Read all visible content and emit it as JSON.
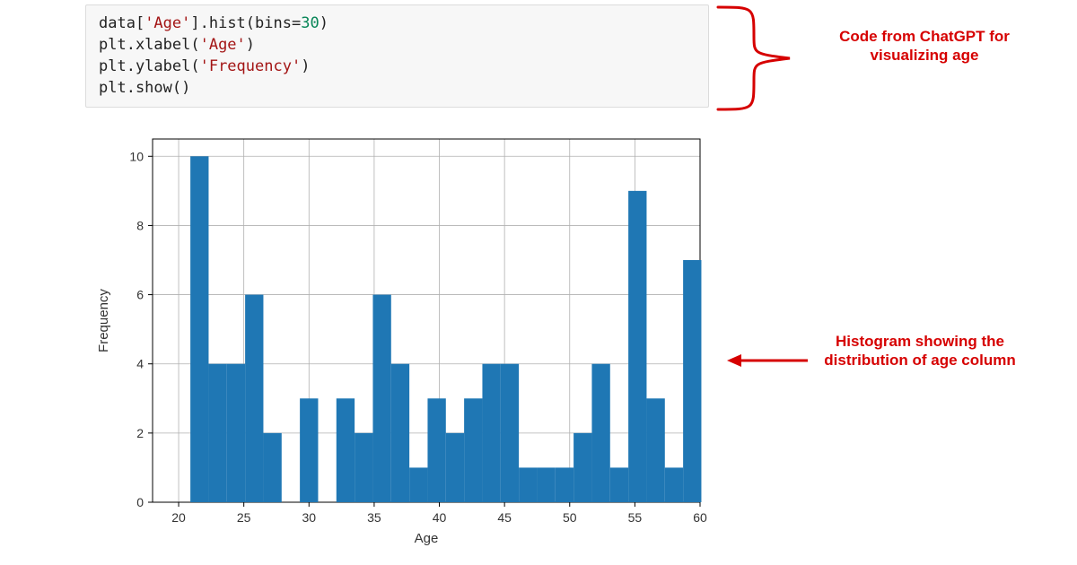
{
  "code": {
    "l1a": "data[",
    "l1s1": "'Age'",
    "l1b": "].hist(bins=",
    "l1n": "30",
    "l1c": ")",
    "l2a": "plt.xlabel(",
    "l2s1": "'Age'",
    "l2b": ")",
    "l3a": "plt.ylabel(",
    "l3s1": "'Frequency'",
    "l3b": ")",
    "l4": "plt.show()"
  },
  "annotations": {
    "code_note": "Code from ChatGPT for visualizing age",
    "hist_note": "Histogram showing the distribution of age column"
  },
  "chart_data": {
    "type": "bar",
    "xlabel": "Age",
    "ylabel": "Frequency",
    "xlim": [
      18,
      60
    ],
    "ylim": [
      0,
      10.5
    ],
    "xticks": [
      20,
      25,
      30,
      35,
      40,
      45,
      50,
      55,
      60
    ],
    "yticks": [
      0,
      2,
      4,
      6,
      8,
      10
    ],
    "bin_width": 1.4,
    "bins": [
      {
        "x": 19.5,
        "y": 0
      },
      {
        "x": 20.9,
        "y": 10
      },
      {
        "x": 22.3,
        "y": 4
      },
      {
        "x": 23.7,
        "y": 4
      },
      {
        "x": 25.1,
        "y": 6
      },
      {
        "x": 26.5,
        "y": 2
      },
      {
        "x": 27.9,
        "y": 0
      },
      {
        "x": 29.3,
        "y": 3
      },
      {
        "x": 30.7,
        "y": 0
      },
      {
        "x": 32.1,
        "y": 3
      },
      {
        "x": 33.5,
        "y": 2
      },
      {
        "x": 34.9,
        "y": 6
      },
      {
        "x": 36.3,
        "y": 4
      },
      {
        "x": 37.7,
        "y": 1
      },
      {
        "x": 39.1,
        "y": 3
      },
      {
        "x": 40.5,
        "y": 2
      },
      {
        "x": 41.9,
        "y": 3
      },
      {
        "x": 43.3,
        "y": 4
      },
      {
        "x": 44.7,
        "y": 4
      },
      {
        "x": 46.1,
        "y": 1
      },
      {
        "x": 47.5,
        "y": 1
      },
      {
        "x": 48.9,
        "y": 1
      },
      {
        "x": 50.3,
        "y": 2
      },
      {
        "x": 51.7,
        "y": 4
      },
      {
        "x": 53.1,
        "y": 1
      },
      {
        "x": 54.5,
        "y": 9
      },
      {
        "x": 55.9,
        "y": 3
      },
      {
        "x": 57.3,
        "y": 1
      },
      {
        "x": 58.7,
        "y": 7
      }
    ]
  }
}
